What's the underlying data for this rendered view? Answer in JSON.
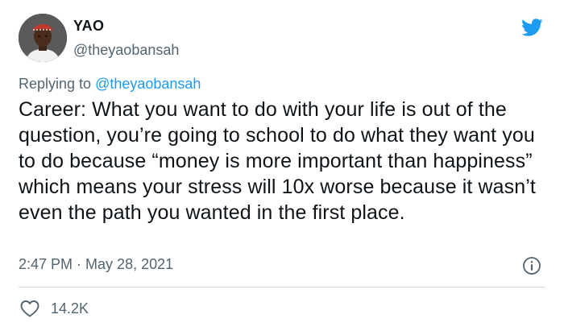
{
  "tweet": {
    "author_name": "YAO",
    "author_handle": "@theyaobansah",
    "reply_prefix": "Replying to ",
    "reply_to": "@theyaobansah",
    "text": "Career: What you want to do with your life is out of the question, you’re going to school to do what they want you to do because “money is more important than happiness” which means your stress will 10x worse because it wasn’t even the path you wanted in the first place.",
    "time": "2:47 PM",
    "separator": " · ",
    "date": "May 28, 2021",
    "likes": "14.2K"
  },
  "icons": {
    "brand": "twitter-bird-icon",
    "info": "info-icon",
    "like": "heart-icon"
  },
  "colors": {
    "brand_blue": "#1d9bf0",
    "secondary_text": "#536471",
    "primary_text": "#0f1419",
    "divider": "#cfd9de"
  }
}
